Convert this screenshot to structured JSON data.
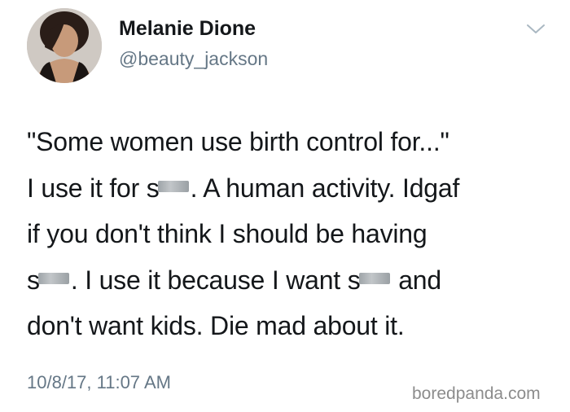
{
  "author": {
    "display_name": "Melanie Dione",
    "handle": "@beauty_jackson"
  },
  "tweet": {
    "line1": "\"Some women use birth control for...\"",
    "line2_a": "I use it for s",
    "line2_b": ". A human activity. Idgaf",
    "line3": "if you don't think I should be having",
    "line4_a": "s",
    "line4_b": ". I use it because I want s",
    "line4_c": " and",
    "line5": "don't want kids. Die mad about it.",
    "timestamp": "10/8/17, 11:07 AM"
  },
  "watermark": "boredpanda.com",
  "icons": {
    "menu": "chevron-down-icon"
  },
  "colors": {
    "text": "#14171a",
    "secondary": "#657786",
    "watermark": "#8c8c8c"
  }
}
